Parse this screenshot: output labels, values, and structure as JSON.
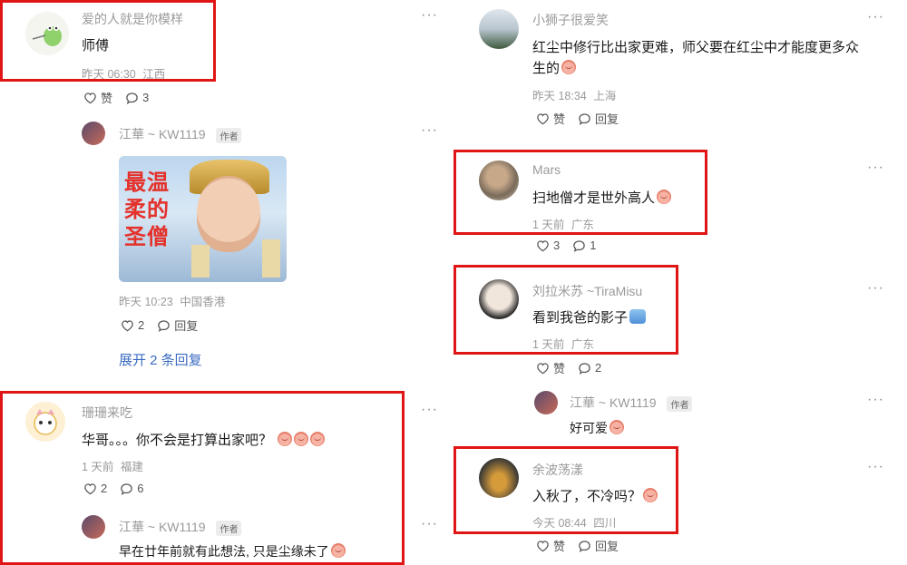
{
  "left": {
    "c1": {
      "name": "爱的人就是你模样",
      "text": "师傅",
      "time": "昨天 06:30",
      "location": "江西",
      "like_label": "赞",
      "reply_count": "3"
    },
    "r1": {
      "name": "江華 ~ KW1119",
      "badge": "作者",
      "poster_text_1": "最温",
      "poster_text_2": "柔的",
      "poster_text_3": "圣僧",
      "time": "昨天 10:23",
      "location": "中国香港",
      "like_count": "2",
      "reply_label": "回复"
    },
    "expand_label": "展开 2 条回复",
    "c2": {
      "name": "珊珊来吃",
      "text": "华哥。。。你不会是打算出家吧？",
      "time": "1 天前",
      "location": "福建",
      "like_count": "2",
      "reply_count": "6"
    },
    "r2": {
      "name": "江華 ~ KW1119",
      "badge": "作者",
      "text": "早在廿年前就有此想法, 只是尘缘未了"
    }
  },
  "right": {
    "c1": {
      "name": "小狮子很爱笑",
      "text_line1": "红尘中修行比出家更难，师父要在红尘中才能度更多众",
      "text_line2": "生的",
      "time": "昨天 18:34",
      "location": "上海",
      "like_label": "赞",
      "reply_label": "回复"
    },
    "c2": {
      "name": "Mars",
      "text": "扫地僧才是世外高人",
      "time": "1 天前",
      "location": "广东",
      "like_count": "3",
      "reply_count": "1"
    },
    "c3": {
      "name": "刘拉米苏 ~TiraMisu",
      "text": "看到我爸的影子",
      "time": "1 天前",
      "location": "广东",
      "like_label": "赞",
      "reply_count": "2"
    },
    "r3": {
      "name": "江華 ~ KW1119",
      "badge": "作者",
      "text": "好可爱"
    },
    "c4": {
      "name": "余波荡漾",
      "text": "入秋了，不冷吗？",
      "time": "今天 08:44",
      "location": "四川",
      "like_label": "赞",
      "reply_label": "回复"
    }
  },
  "icons": {
    "more": "more-icon",
    "like": "heart-icon",
    "reply": "comment-bubble-icon"
  },
  "colors": {
    "highlight": "#e01515",
    "link": "#3b6cc2",
    "meta": "#9a9a9a"
  }
}
